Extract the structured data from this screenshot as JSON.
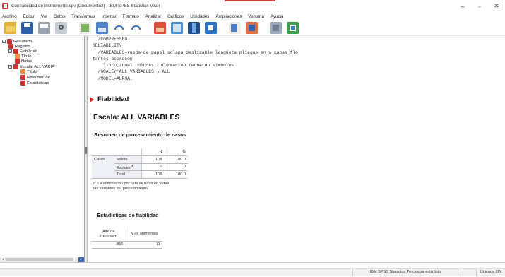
{
  "window": {
    "title": "Confiabilidad de instrumento.spv [Documento2] - IBM SPSS Statistics Visor",
    "controls": [
      "–",
      "▫",
      "✕"
    ]
  },
  "menu": [
    "Archivo",
    "Editar",
    "Ver",
    "Datos",
    "Transformar",
    "Insertar",
    "Formato",
    "Analizar",
    "Gráficos",
    "Utilidades",
    "Ampliaciones",
    "Ventana",
    "Ayuda"
  ],
  "toolbar": [
    "open-icon",
    "save-icon",
    "print-icon",
    "print-preview-icon",
    "export-icon",
    "recall-dialog-icon",
    "undo-icon",
    "redo-icon",
    "goto-data-icon",
    "goto-case-icon",
    "goto-variable-icon",
    "variables-icon",
    "insert-output-icon",
    "designate-window-icon",
    "run-icon",
    "stop-icon"
  ],
  "tree": {
    "items": [
      {
        "label": "Resultado",
        "icon": "output-icon"
      },
      {
        "label": "Registro",
        "icon": "log-icon"
      },
      {
        "label": "Fiabilidad",
        "icon": "procedure-icon"
      },
      {
        "label": "Título",
        "icon": "title-icon"
      },
      {
        "label": "Notas",
        "icon": "notes-icon"
      },
      {
        "label": "Escala: ALL VARIA",
        "icon": "procedure-icon"
      },
      {
        "label": "Título",
        "icon": "title-icon"
      },
      {
        "label": "Resumen de",
        "icon": "table-icon"
      },
      {
        "label": "Estadísticas",
        "icon": "table-icon"
      }
    ]
  },
  "syntax": [
    "  /COMPRESSED.",
    "RELIABILITY",
    "  /VARIABLES=rueda_de_papel solapa_deslizable lengüeta pliegue_en_v capas_flo",
    "tantes acordeón",
    "    libro_tunel colores información recuerdo símbolos",
    "  /SCALE('ALL VARIABLES') ALL",
    "  /MODEL=ALPHA."
  ],
  "output": {
    "section_title": "Fiabilidad",
    "scale_title": "Escala: ALL VARIABLES",
    "case_table": {
      "title": "Resumen de procesamiento de casos",
      "headers": [
        "N",
        "%"
      ],
      "group": "Casos",
      "rows": [
        {
          "label": "Válido",
          "n": "108",
          "pct": "100.0"
        },
        {
          "label": "Excluido",
          "sup": "a",
          "n": "0",
          "pct": "0"
        },
        {
          "label": "Total",
          "n": "108",
          "pct": "100.0"
        }
      ],
      "footnote": "a. La eliminación por lista se basa en todas las variables del procedimiento."
    },
    "rel_table": {
      "title": "Estadísticas de fiabilidad",
      "headers": [
        "Alfa de Cronbach",
        "N de elementos"
      ],
      "values": [
        ".856",
        "11"
      ]
    }
  },
  "status": {
    "processor": "IBM SPSS Statistics Processor está listo",
    "unicode": "Unicode:ON"
  },
  "colors": {
    "accent": "#d04040",
    "arrow": "#d42020",
    "selection": "#3867b5"
  }
}
